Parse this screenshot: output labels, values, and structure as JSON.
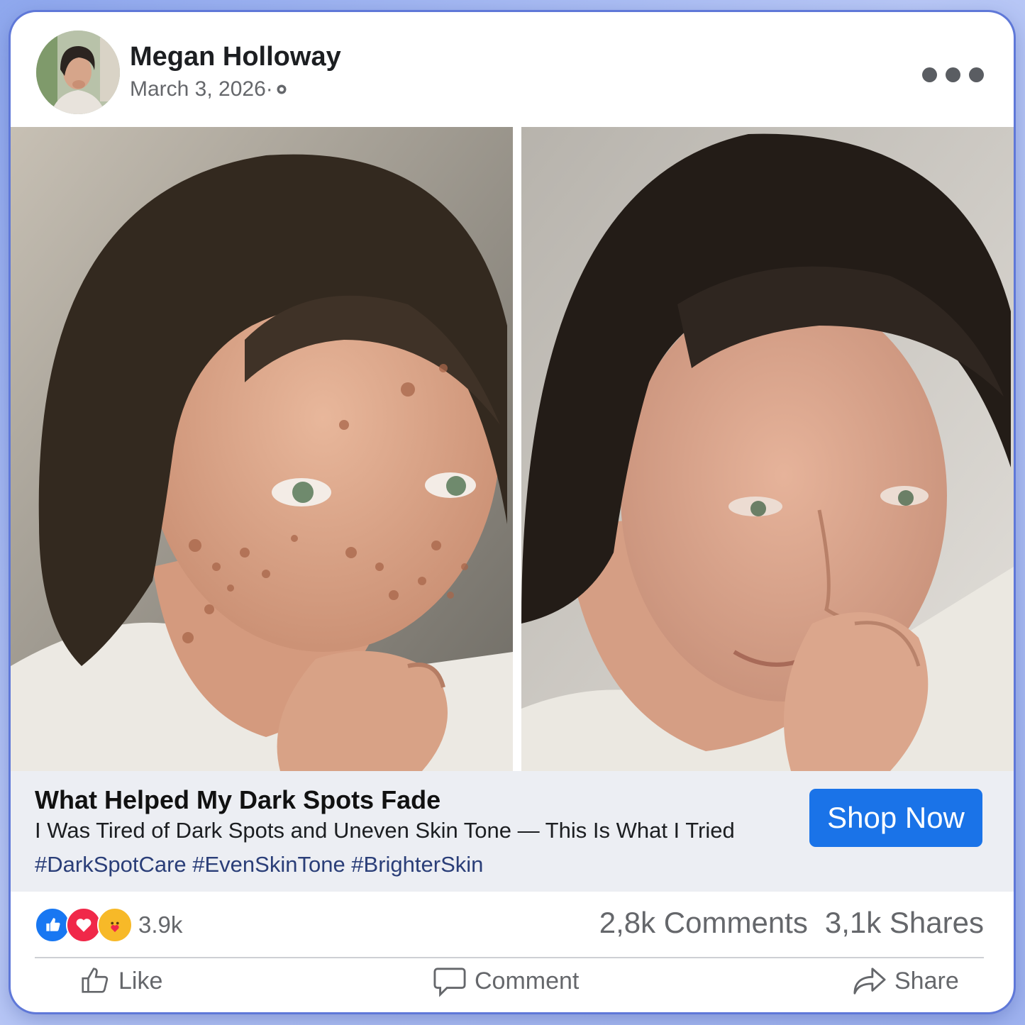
{
  "post": {
    "author": "Megan Holloway",
    "date": "March 3, 2026",
    "date_sep": "·",
    "privacy_icon": "globe-icon",
    "menu_icon": "more-options-icon"
  },
  "images": {
    "left": "before-photo",
    "right": "after-photo"
  },
  "link": {
    "headline": "What Helped My Dark Spots Fade",
    "subline": "I Was Tired of Dark Spots and Uneven Skin Tone — This Is What I Tried",
    "hashtags": "#DarkSpotCare #EvenSkinTone #BrighterSkin",
    "cta": "Shop Now"
  },
  "stats": {
    "reaction_icons": [
      "like-icon",
      "love-icon",
      "care-icon"
    ],
    "reactions": "3.9k",
    "comments": "2,8k Comments",
    "shares": "3,1k Shares"
  },
  "actions": {
    "like": "Like",
    "comment": "Comment",
    "share": "Share"
  },
  "colors": {
    "accent": "#1a73e8",
    "like_blue": "#1877f2",
    "love_red": "#f02849",
    "care_yellow": "#f7b928",
    "hashtag": "#2a3e78"
  }
}
